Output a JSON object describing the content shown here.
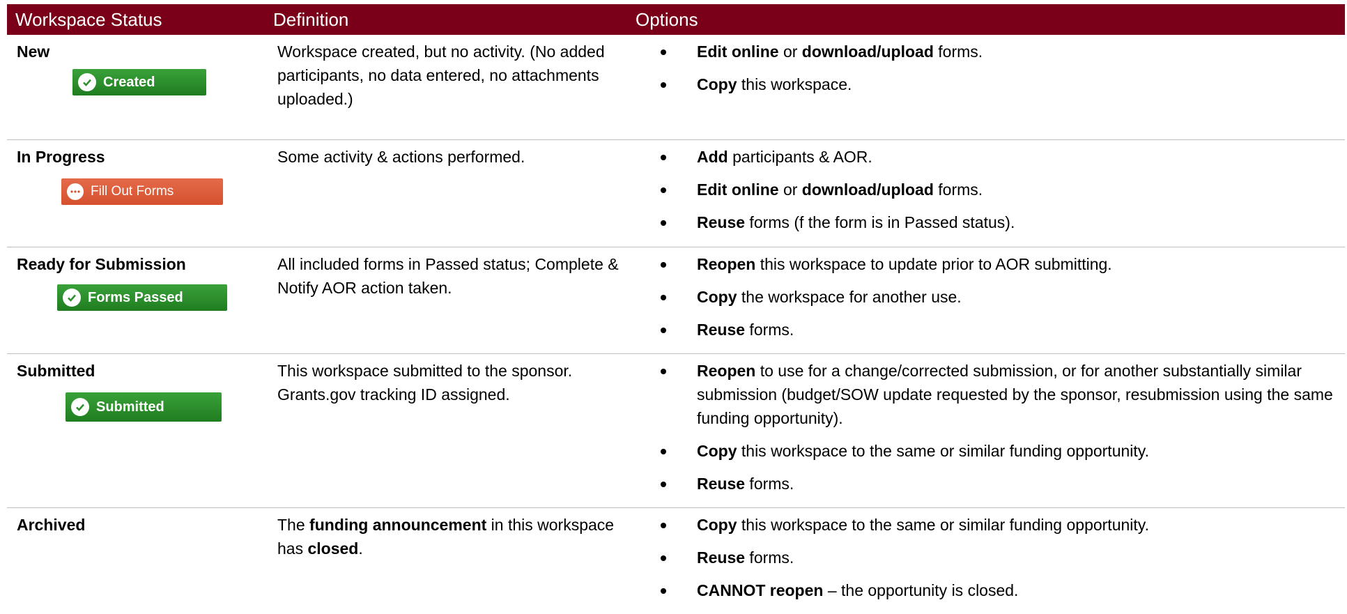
{
  "header": {
    "col1": "Workspace Status",
    "col2": "Definition",
    "col3": "Options"
  },
  "colors": {
    "header_bg": "#7a0019",
    "badge_green": "#2f8f2f",
    "badge_orange": "#d9583a"
  },
  "rows": [
    {
      "status": "New",
      "badge": {
        "label": "Created",
        "icon": "check-circle-icon"
      },
      "definition": {
        "a": "Workspace created, but no activity. (No added participants, no data entered, no attachments uploaded.)"
      },
      "options": [
        {
          "b1": "Edit online",
          "t1": " or ",
          "b2": "download/upload",
          "t2": " forms."
        },
        {
          "b1": "Copy",
          "t1": " this workspace."
        }
      ]
    },
    {
      "status": "In Progress",
      "badge": {
        "label": "Fill Out Forms",
        "icon": "ellipsis-circle-icon"
      },
      "definition": {
        "a": "Some activity & actions performed."
      },
      "options": [
        {
          "b1": "Add",
          "t1": " participants & AOR."
        },
        {
          "b1": "Edit online",
          "t1": " or ",
          "b2": "download/upload",
          "t2": " forms."
        },
        {
          "b1": "Reuse",
          "t1": " forms (f the form is in Passed status)."
        }
      ]
    },
    {
      "status": "Ready for Submission",
      "badge": {
        "label": "Forms Passed",
        "icon": "check-circle-icon"
      },
      "definition": {
        "a": "All included forms in Passed status; Complete & Notify AOR action taken."
      },
      "options": [
        {
          "b1": "Reopen",
          "t1": " this workspace to update prior to AOR submitting."
        },
        {
          "b1": "Copy",
          "t1": " the workspace for another use."
        },
        {
          "b1": "Reuse",
          "t1": " forms."
        }
      ]
    },
    {
      "status": "Submitted",
      "badge": {
        "label": "Submitted",
        "icon": "check-circle-icon"
      },
      "definition": {
        "a": "This workspace submitted to the sponsor. Grants.gov tracking ID assigned."
      },
      "options": [
        {
          "b1": "Reopen",
          "t1": " to use for a change/corrected submission, or for another substantially similar submission (budget/SOW update requested by the sponsor, resubmission using the same funding opportunity)."
        },
        {
          "b1": "Copy",
          "t1": " this workspace to the same or similar funding opportunity."
        },
        {
          "b1": "Reuse",
          "t1": " forms."
        }
      ]
    },
    {
      "status": "Archived",
      "definition": {
        "a": "The ",
        "b": "funding announcement",
        "c": " in this workspace has ",
        "d": "closed",
        "e": "."
      },
      "options": [
        {
          "b1": "Copy",
          "t1": " this workspace to the same or similar funding opportunity."
        },
        {
          "b1": "Reuse",
          "t1": " forms."
        },
        {
          "b1": "CANNOT reopen",
          "t1": " – the opportunity is closed."
        }
      ]
    }
  ]
}
